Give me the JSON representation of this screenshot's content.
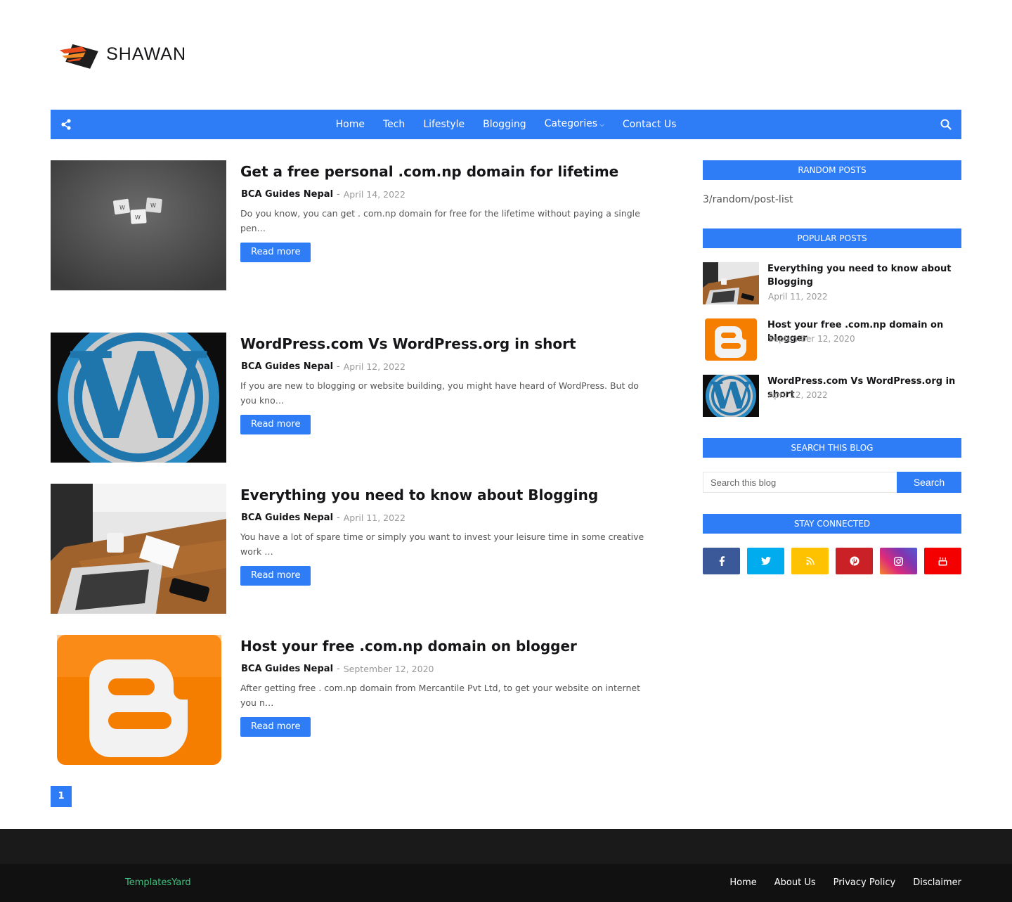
{
  "site": {
    "logo_text": "SHAWAN"
  },
  "nav": {
    "items": [
      "Home",
      "Tech",
      "Lifestyle",
      "Blogging",
      "Categories",
      "Contact Us"
    ]
  },
  "posts": [
    {
      "title": "Get a free personal .com.np domain for lifetime",
      "author": "BCA Guides Nepal",
      "date": "April 14, 2022",
      "snippet": "Do you know, you can get . com.np   domain  for free for the lifetime without paying a single pen…",
      "read_more": "Read more"
    },
    {
      "title": "WordPress.com Vs WordPress.org in short",
      "author": "BCA Guides Nepal",
      "date": "April 12, 2022",
      "snippet": "If you are new to blogging or website building, you might have heard of WordPress. But do you kno…",
      "read_more": "Read more"
    },
    {
      "title": "Everything you need to know about Blogging",
      "author": "BCA Guides Nepal",
      "date": "April 11, 2022",
      "snippet": "You have a lot of spare time or simply you want to invest your leisure time in some creative work …",
      "read_more": "Read more"
    },
    {
      "title": "Host your free .com.np domain on blogger",
      "author": "BCA Guides Nepal",
      "date": "September 12, 2020",
      "snippet": "After getting free . com.np   domain from Mercantile Pvt Ltd, to get your website on internet you n…",
      "read_more": "Read more"
    }
  ],
  "pagination": {
    "current": "1"
  },
  "sidebar": {
    "random_title": "Random Posts",
    "random_text": "3/random/post-list",
    "popular_title": "Popular Posts",
    "popular": [
      {
        "title": "Everything you need to know about Blogging",
        "date": "April 11, 2022"
      },
      {
        "title": "Host your free .com.np domain on blogger",
        "date": "September 12, 2020"
      },
      {
        "title": "WordPress.com Vs WordPress.org in short",
        "date": "April 12, 2022"
      }
    ],
    "search_title": "Search This Blog",
    "search_placeholder": "Search this blog",
    "search_button": "Search",
    "stay_title": "Stay Connected",
    "social": [
      {
        "icon": "facebook-icon",
        "color": "#3b5998"
      },
      {
        "icon": "twitter-icon",
        "color": "#00acee"
      },
      {
        "icon": "rss-icon",
        "color": "#ffc200"
      },
      {
        "icon": "pinterest-icon",
        "color": "#ca2127"
      },
      {
        "icon": "instagram-icon",
        "color": "#c13584"
      },
      {
        "icon": "youtube-icon",
        "color": "#f50000"
      }
    ]
  },
  "footer": {
    "credit": "TemplatesYard",
    "links": [
      "Home",
      "About Us",
      "Privacy Policy",
      "Disclaimer"
    ]
  },
  "colors": {
    "accent": "#2e7cf6",
    "footer_dark": "#111111",
    "credit_green": "#3fbf7f"
  }
}
